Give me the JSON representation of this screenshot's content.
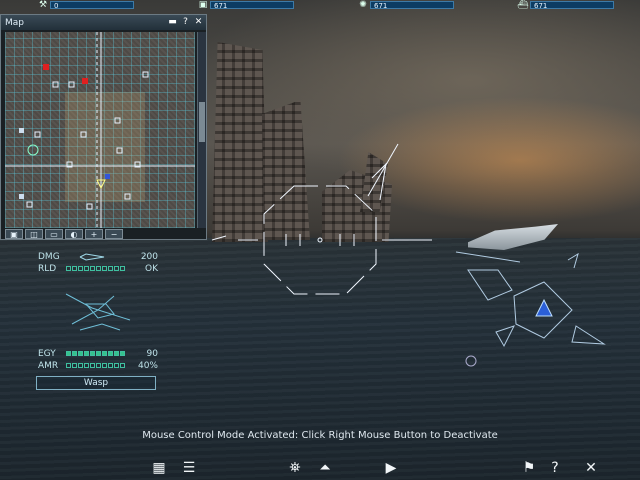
{
  "top_stats": [
    {
      "icon": "tool-icon",
      "value": "0"
    },
    {
      "icon": "cube-icon",
      "value": "671"
    },
    {
      "icon": "gear-icon",
      "value": "671"
    },
    {
      "icon": "ship-icon",
      "value": "671"
    }
  ],
  "map_window": {
    "title": "Map",
    "minimize_glyph": "▬",
    "help_glyph": "?",
    "close_glyph": "✕",
    "tools": [
      "▣",
      "◫",
      "▭",
      "◐",
      "+",
      "−"
    ]
  },
  "unit": {
    "dmg_label": "DMG",
    "dmg_value": "200",
    "rld_label": "RLD",
    "rld_value": "OK",
    "egy_label": "EGY",
    "egy_value": "90",
    "egy_level": 1.0,
    "amr_label": "AMR",
    "amr_value": "40%",
    "amr_level": 0.4,
    "name": "Wasp"
  },
  "message": "Mouse Control Mode Activated: Click Right Mouse Button to Deactivate",
  "bottom_buttons": {
    "grid": "▦",
    "list": "☰",
    "pilot": "⛯",
    "up": "⏶",
    "play": "▶",
    "map_pin": "⚑",
    "help": "?",
    "close": "✕"
  },
  "colors": {
    "accent": "#35c28b",
    "hud": "#e6f3ff",
    "map_red": "#e02020"
  }
}
